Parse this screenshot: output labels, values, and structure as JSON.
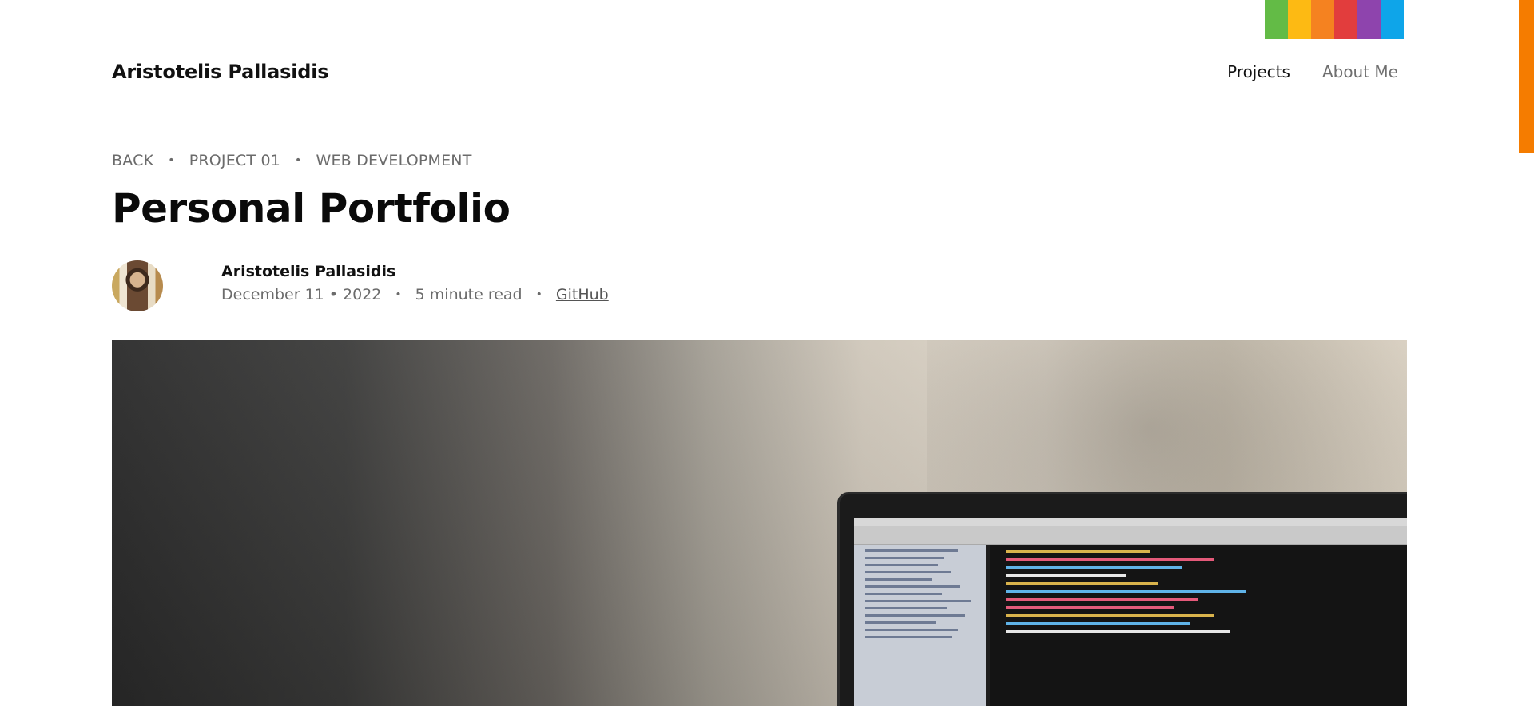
{
  "header": {
    "site_title": "Aristotelis Pallasidis",
    "nav": {
      "projects": "Projects",
      "about": "About Me"
    },
    "accent_colors": [
      "#63bb46",
      "#fdba13",
      "#f58220",
      "#e23d3d",
      "#8e44ad",
      "#0ea5e9"
    ],
    "side_accent_color": "#f57c00"
  },
  "breadcrumb": {
    "back": "BACK",
    "project": "PROJECT 01",
    "category": "WEB DEVELOPMENT",
    "separator": "•"
  },
  "post": {
    "title": "Personal Portfolio",
    "author": "Aristotelis Pallasidis",
    "date": "December 11 • 2022",
    "read_time": "5 minute read",
    "link_label": "GitHub",
    "separator": "•"
  },
  "hero": {
    "icon": "laptop-code-photo"
  }
}
